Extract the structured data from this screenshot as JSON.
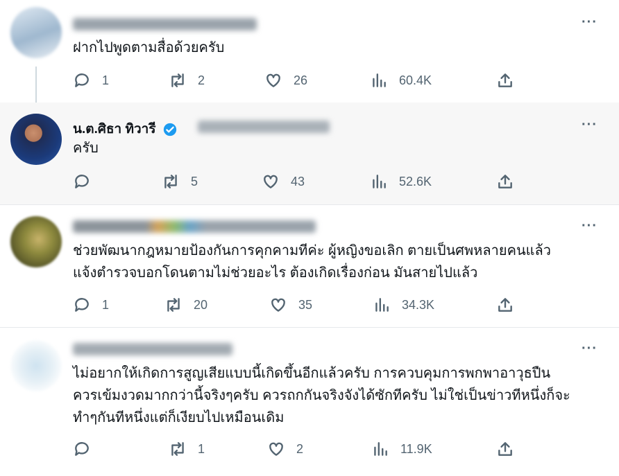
{
  "tweets": [
    {
      "text": [
        "ฝากไปพูดตามสื่อด้วยครับ"
      ],
      "stats": {
        "replies": "1",
        "retweets": "2",
        "likes": "26",
        "views": "60.4K"
      }
    },
    {
      "name": "น.ต.ศิธา ทิวารี",
      "verified": true,
      "text": [
        "ครับ"
      ],
      "stats": {
        "replies": "",
        "retweets": "5",
        "likes": "43",
        "views": "52.6K"
      }
    },
    {
      "text": [
        "ช่วยพัฒนากฎหมายป้องกันการคุกคามทีค่ะ ผู้หญิงขอเลิก ตายเป็นศพหลายคนแล้ว",
        "แจ้งตำรวจบอกโดนตามไม่ช่วยอะไร ต้องเกิดเรื่องก่อน มันสายไปแล้ว"
      ],
      "stats": {
        "replies": "1",
        "retweets": "20",
        "likes": "35",
        "views": "34.3K"
      }
    },
    {
      "text": [
        "ไม่อยากให้เกิดการสูญเสียแบบนี้เกิดขึ้นอีกแล้วครับ การควบคุมการพกพาอาวุธปืน",
        "ควรเข้มงวดมากกว่านี้จริงๆครับ ควรถกกันจริงจังได้ซักทีครับ ไม่ใช่เป็นข่าวทีหนึ่งก็จะ",
        "ทำๆกันทีหนึ่งแต่ก็เงียบไปเหมือนเดิม"
      ],
      "stats": {
        "replies": "",
        "retweets": "1",
        "likes": "2",
        "views": "11.9K"
      }
    }
  ],
  "more_label": "···",
  "colors": {
    "text": "#0f1419",
    "muted": "#536471",
    "highlight_bg": "#f7f7f7",
    "verified": "#1d9bf0"
  }
}
